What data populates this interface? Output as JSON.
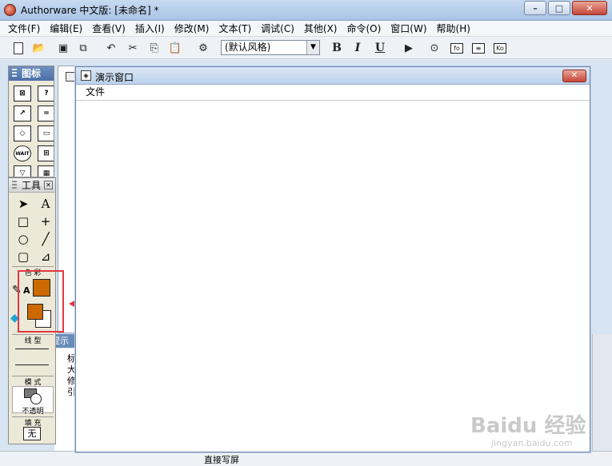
{
  "window": {
    "title": "Authorware 中文版: [未命名] *"
  },
  "menubar": {
    "items": [
      "文件(F)",
      "编辑(E)",
      "查看(V)",
      "插入(I)",
      "修改(M)",
      "文本(T)",
      "调试(C)",
      "其他(X)",
      "命令(O)",
      "窗口(W)",
      "帮助(H)"
    ]
  },
  "toolbar": {
    "style_value": "(默认风格)",
    "bold": "B",
    "italic": "I",
    "underline": "U",
    "fo_label": "fo",
    "ko_label": "Ko"
  },
  "icons_palette": {
    "title": "图标",
    "icon_labels": [
      "WAIT"
    ]
  },
  "tools_palette": {
    "title": "工具",
    "color_label": "色 彩",
    "text_color_letter": "A",
    "line_label": "线 型",
    "mode_label": "模 式",
    "mode_value": "不透明",
    "fill_label": "填 充",
    "fill_value": "无",
    "colors": {
      "fill": "#cc6a00",
      "highlight": "#e3383e"
    }
  },
  "presentation_window": {
    "title": "演示窗口",
    "menu_file": "文件"
  },
  "background": {
    "prompt_tab": "提示",
    "text_chars": "标\n大\n修\n引",
    "status_text": "直接写屏"
  },
  "watermark": {
    "text": "Baidu 经验",
    "sub": "jingyan.baidu.com"
  }
}
